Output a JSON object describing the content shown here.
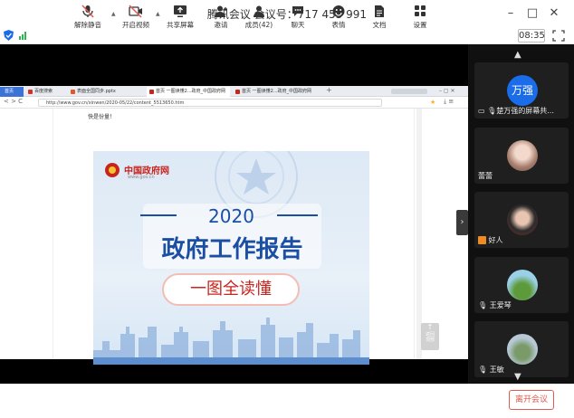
{
  "title": "腾讯会议 会议号：717 455 991",
  "status": {
    "clock": "08:35"
  },
  "browser": {
    "tabs": [
      "首页",
      "百度搜索",
      "表面全国同步.pptx",
      "",
      "首页 一图读懂2...政府_中国政府网",
      "首页 一图读懂2...政府_中国政府网"
    ],
    "url": "http://www.gov.cn/xinwen/2020-05/22/content_5513650.htm",
    "page_text": "快是份量！",
    "poster": {
      "logo": "中国政府网",
      "logo_sub": "www.gov.cn",
      "year": "2020",
      "heading": "政府工作报告",
      "subheading": "一图全读懂"
    },
    "back_to_top": "返回顶部"
  },
  "participants": [
    {
      "avatar_text": "万强",
      "label": "楚万强的屏幕共..."
    },
    {
      "label": "蕾蕾"
    },
    {
      "label": "好人"
    },
    {
      "label": "王爱琴"
    },
    {
      "label": "王敏"
    }
  ],
  "toolbar": {
    "unmute": "解除静音",
    "video": "开启视频",
    "share": "共享屏幕",
    "invite": "邀请",
    "members": "成员(42)",
    "chat": "聊天",
    "reactions": "表情",
    "docs": "文档",
    "settings": "设置",
    "leave": "离开会议"
  },
  "colors": {
    "accent": "#1a6ce8",
    "leave": "#e25a4f",
    "banner_text": "#1b4fa3",
    "gov_red": "#c8241e"
  }
}
